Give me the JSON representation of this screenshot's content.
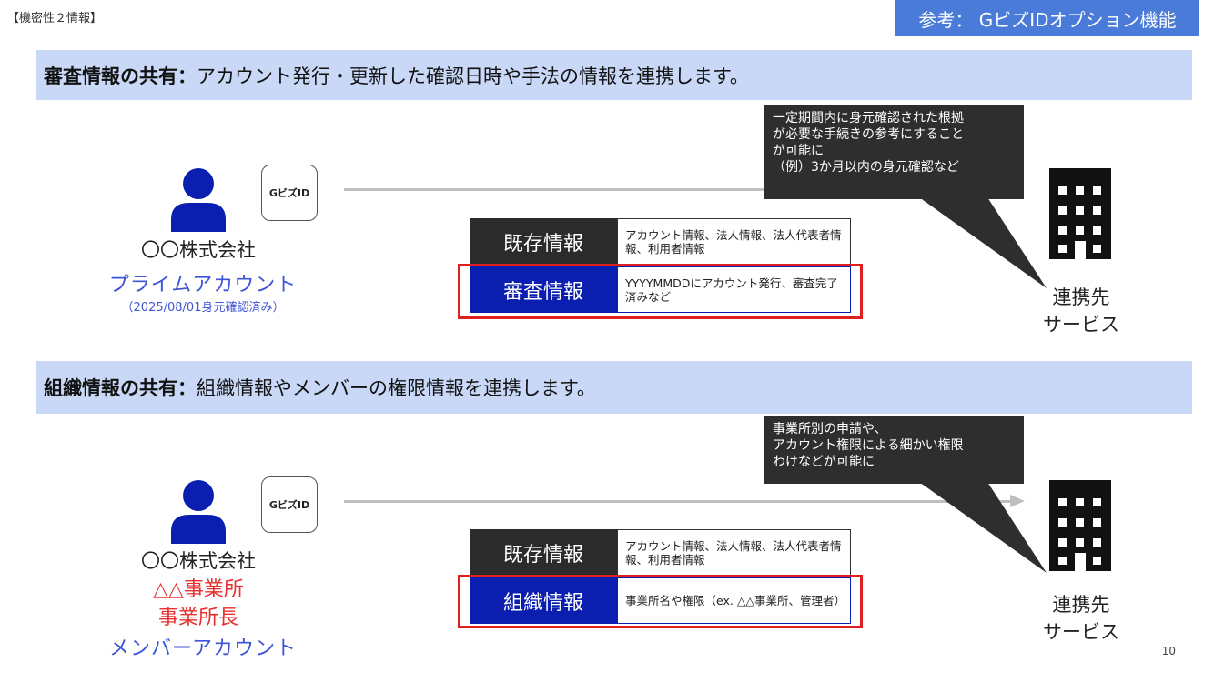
{
  "header": {
    "confidential": "【機密性２情報】",
    "reference_tag": "参考： GビズIDオプション機能"
  },
  "sections": [
    {
      "band_bold": "審査情報の共有：",
      "band_text": "アカウント発行・更新した確認日時や手法の情報を連携します。",
      "company": "〇〇株式会社",
      "account_lines": [
        "プライムアカウント"
      ],
      "account_sub": "（2025/08/01身元確認済み）",
      "gbiz_label": "GビズID",
      "callout": [
        "一定期間内に身元確認された根拠",
        "が必要な手続きの参考にすること",
        "が可能に",
        "（例）3か月以内の身元確認など"
      ],
      "rows": [
        {
          "label": "既存情報",
          "desc": "アカウント情報、法人情報、法人代表者情報、利用者情報",
          "style": "dark"
        },
        {
          "label": "審査情報",
          "desc": "YYYYMMDDにアカウント発行、審査完了済みなど",
          "style": "blue"
        }
      ],
      "service": [
        "連携先",
        "サービス"
      ]
    },
    {
      "band_bold": "組織情報の共有：",
      "band_text": "組織情報やメンバーの権限情報を連携します。",
      "company": "〇〇株式会社",
      "account_red": [
        "△△事業所",
        "事業所長"
      ],
      "account_lines": [
        "メンバーアカウント"
      ],
      "gbiz_label": "GビズID",
      "callout": [
        "事業所別の申請や、",
        "アカウント権限による細かい権限",
        "わけなどが可能に"
      ],
      "rows": [
        {
          "label": "既存情報",
          "desc": "アカウント情報、法人情報、法人代表者情報、利用者情報",
          "style": "dark"
        },
        {
          "label": "組織情報",
          "desc": "事業所名や権限（ex. △△事業所、管理者）",
          "style": "blue"
        }
      ],
      "service": [
        "連携先",
        "サービス"
      ]
    }
  ],
  "page_number": "10",
  "icons": {
    "person": "person-icon",
    "building": "building-icon"
  },
  "colors": {
    "band": "#c8d8f6",
    "accent_blue": "#0a1fb0",
    "tag": "#4a7bd8",
    "highlight_red": "#e01f1f",
    "account_blue": "#3f55d6",
    "account_red": "#e82f2f"
  }
}
